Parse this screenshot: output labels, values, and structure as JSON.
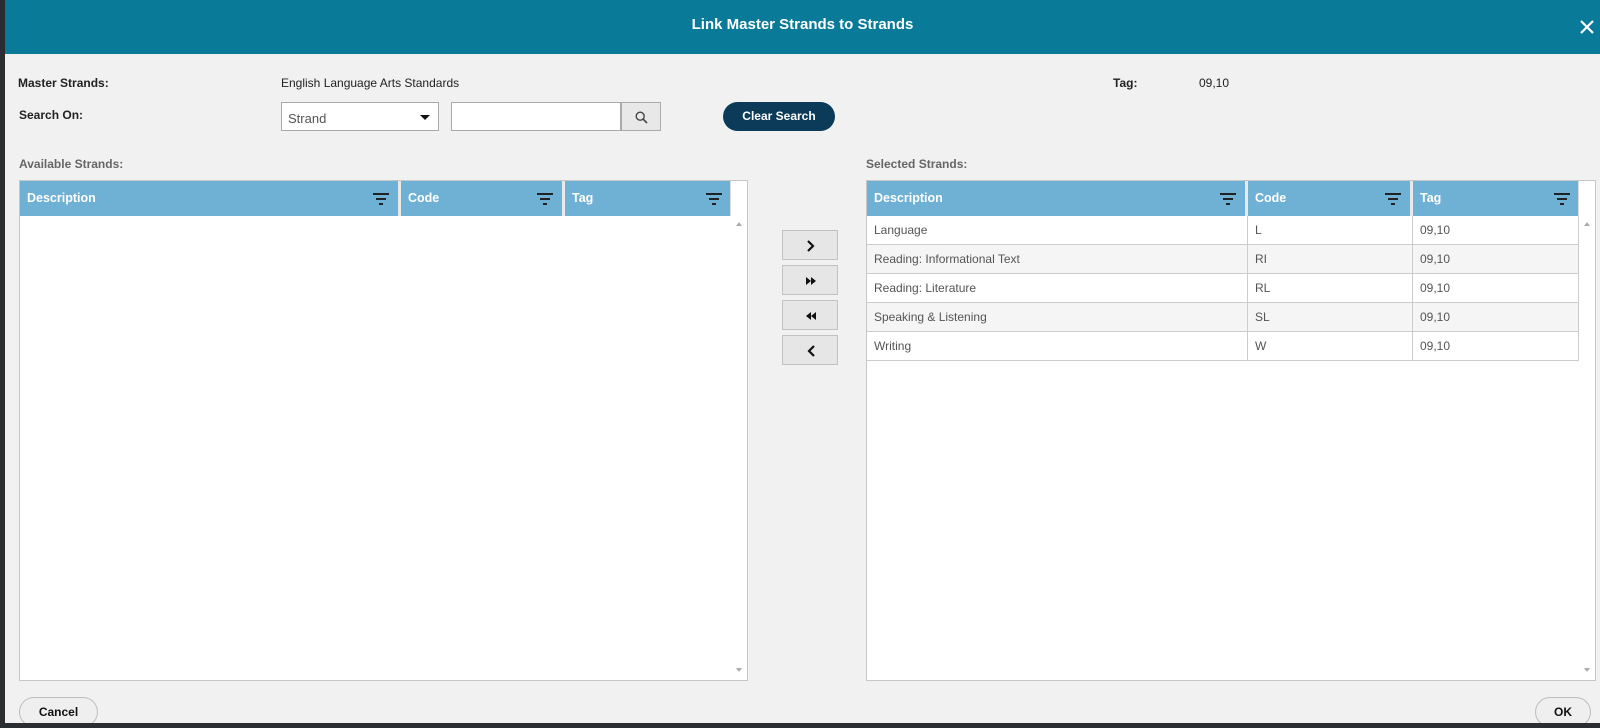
{
  "dialog": {
    "title": "Link Master Strands to Strands",
    "close_icon": "close-icon"
  },
  "form": {
    "master_strands_label": "Master Strands:",
    "master_strands_value": "English Language Arts Standards",
    "tag_label": "Tag:",
    "tag_value": "09,10",
    "search_on_label": "Search On:",
    "search_on_selected": "Strand",
    "search_value": "",
    "search_icon": "search-icon",
    "clear_search_label": "Clear Search"
  },
  "available": {
    "label": "Available Strands:",
    "columns": [
      "Description",
      "Code",
      "Tag"
    ],
    "rows": []
  },
  "selected": {
    "label": "Selected Strands:",
    "columns": [
      "Description",
      "Code",
      "Tag"
    ],
    "rows": [
      [
        "Language",
        "L",
        "09,10"
      ],
      [
        "Reading: Informational Text",
        "RI",
        "09,10"
      ],
      [
        "Reading: Literature",
        "RL",
        "09,10"
      ],
      [
        "Speaking & Listening",
        "SL",
        "09,10"
      ],
      [
        "Writing",
        "W",
        "09,10"
      ]
    ]
  },
  "move_buttons": {
    "move_one_right": "chevron-right-icon",
    "move_all_right": "double-chevron-right-icon",
    "move_all_left": "double-chevron-left-icon",
    "move_one_left": "chevron-left-icon"
  },
  "footer": {
    "cancel_label": "Cancel",
    "ok_label": "OK"
  },
  "colors": {
    "titlebar": "#0a7a99",
    "grid_header": "#6fb0d5",
    "clear_button": "#0b3b58"
  }
}
